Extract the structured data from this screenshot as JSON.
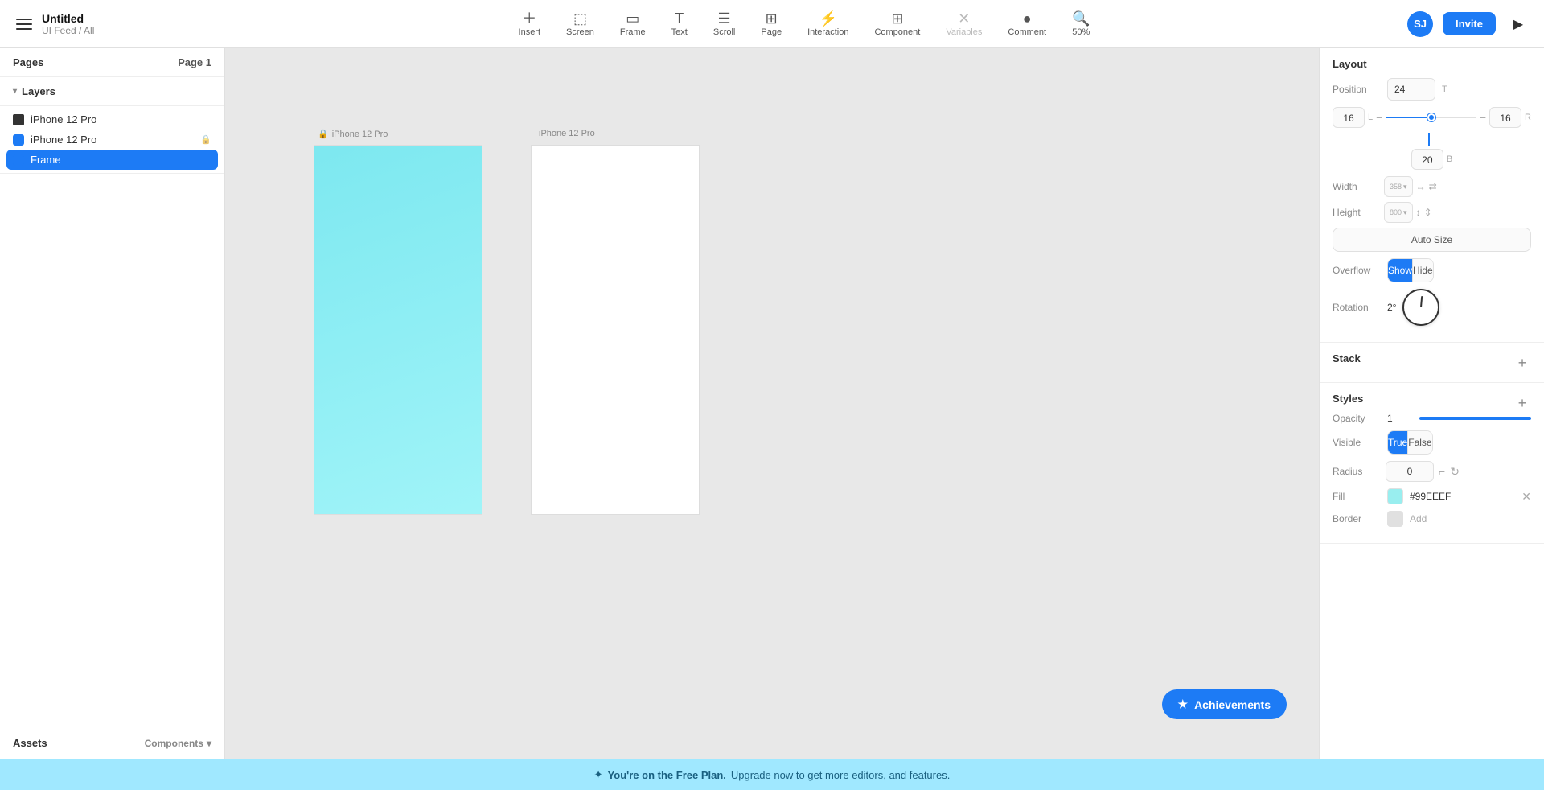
{
  "app": {
    "title": "Untitled",
    "subtitle": "UI Feed / All",
    "zoom": "50%"
  },
  "toolbar": {
    "insert": "Insert",
    "screen": "Screen",
    "frame": "Frame",
    "text": "Text",
    "scroll": "Scroll",
    "page": "Page",
    "interaction": "Interaction",
    "component": "Component",
    "variables": "Variables",
    "comment": "Comment",
    "zoom": "50%",
    "invite": "Invite",
    "user_initials": "SJ"
  },
  "left_panel": {
    "pages_label": "Pages",
    "page1": "Page 1",
    "layers_label": "Layers",
    "layers": [
      {
        "name": "iPhone 12 Pro",
        "type": "frame-dark",
        "indent": false
      },
      {
        "name": "iPhone 12 Pro",
        "type": "frame-blue",
        "indent": false,
        "lock": true
      },
      {
        "name": "Frame",
        "type": "frame-blue",
        "indent": true,
        "selected": true
      }
    ],
    "assets_label": "Assets",
    "assets_filter": "Components"
  },
  "canvas": {
    "frame1_label": "iPhone 12 Pro",
    "frame2_label": "iPhone 12 Pro",
    "frame1_lock": true
  },
  "achievements": {
    "label": "Achievements"
  },
  "right_panel": {
    "layout_title": "Layout",
    "position_label": "Position",
    "position_value": "24",
    "position_t": "T",
    "margin_left": "16",
    "margin_left_label": "L",
    "margin_right": "16",
    "margin_right_label": "R",
    "margin_bottom": "20",
    "margin_bottom_label": "B",
    "width_label": "Width",
    "width_value": "358",
    "height_label": "Height",
    "height_value": "800",
    "autosize_label": "Auto Size",
    "overflow_label": "Overflow",
    "overflow_show": "Show",
    "overflow_hide": "Hide",
    "rotation_label": "Rotation",
    "rotation_value": "2°",
    "stack_label": "Stack",
    "styles_label": "Styles",
    "opacity_label": "Opacity",
    "opacity_value": "1",
    "visible_label": "Visible",
    "visible_true": "True",
    "visible_false": "False",
    "radius_label": "Radius",
    "radius_value": "0",
    "fill_label": "Fill",
    "fill_color": "#99EEEF",
    "fill_hex": "#99EEEF",
    "border_label": "Border",
    "border_add": "Add"
  },
  "bottom_bar": {
    "plan_text": "You're on the Free Plan.",
    "upgrade_text": "Upgrade now to get more editors, and features."
  }
}
